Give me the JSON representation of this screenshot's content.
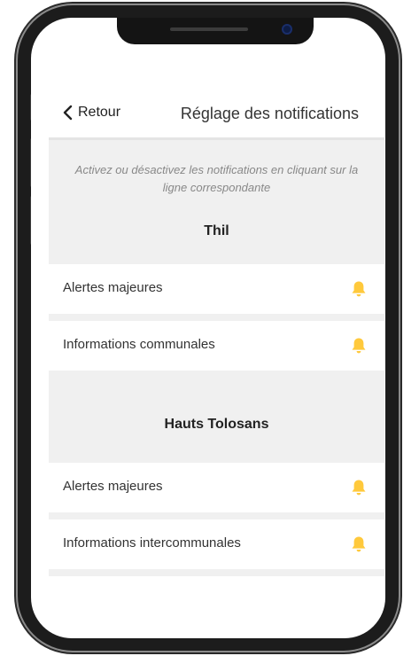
{
  "header": {
    "back_label": "Retour",
    "title": "Réglage des notifications"
  },
  "info": {
    "text": "Activez ou désactivez les notifications en cliquant sur la ligne correspondante"
  },
  "groups": [
    {
      "title": "Thil",
      "items": [
        {
          "label": "Alertes majeures",
          "icon": "bell-icon",
          "icon_color": "#FFC93C"
        },
        {
          "label": "Informations communales",
          "icon": "bell-icon",
          "icon_color": "#FFC93C"
        }
      ]
    },
    {
      "title": "Hauts Tolosans",
      "items": [
        {
          "label": "Alertes majeures",
          "icon": "bell-icon",
          "icon_color": "#FFC93C"
        },
        {
          "label": "Informations intercommunales",
          "icon": "bell-icon",
          "icon_color": "#FFC93C"
        }
      ]
    }
  ],
  "colors": {
    "accent": "#FFC93C",
    "section_bg": "#F0F0F0",
    "text": "#333333"
  }
}
